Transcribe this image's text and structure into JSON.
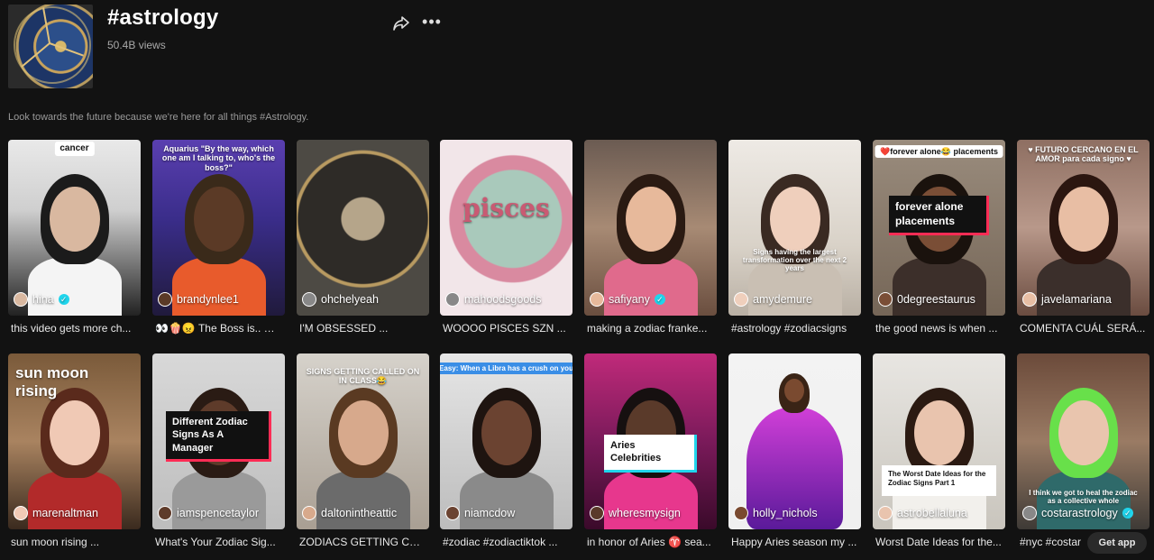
{
  "header": {
    "title": "#astrology",
    "views": "50.4B views",
    "share_icon": "share-icon",
    "more_icon": "more-icon"
  },
  "description": "Look towards the future because we're here for all things #Astrology.",
  "videos": [
    {
      "author": "hina",
      "verified": true,
      "title": "this video gets more ch...",
      "overlay": "cancer"
    },
    {
      "author": "brandynlee1",
      "verified": false,
      "title": "👀🍿😠 The Boss is.. 😰 ...",
      "overlay": "Aquarius \"By the way, which one am I talking to, who's the boss?\""
    },
    {
      "author": "ohchelyeah",
      "verified": false,
      "title": "I'M OBSESSED ...",
      "overlay": ""
    },
    {
      "author": "mahoodsgoods",
      "verified": false,
      "title": "WOOOO PISCES SZN ...",
      "overlay": "pisces"
    },
    {
      "author": "safiyany",
      "verified": true,
      "title": "making a zodiac franke...",
      "overlay": ""
    },
    {
      "author": "amydemure",
      "verified": false,
      "title": "#astrology #zodiacsigns",
      "overlay": "Signs having the largest transformation over the next 2 years"
    },
    {
      "author": "0degreestaurus",
      "verified": false,
      "title": "the good news is when ...",
      "overlay": "❤️forever alone😂 placements",
      "box": "forever alone placements"
    },
    {
      "author": "javelamariana",
      "verified": false,
      "title": "COMENTA CUÁL SERÁ...",
      "overlay": "♥ FUTURO CERCANO EN EL AMOR para cada signo ♥"
    },
    {
      "author": "marenaltman",
      "verified": false,
      "title": "sun moon rising ...",
      "overlay": "sun moon rising"
    },
    {
      "author": "iamspencetaylor",
      "verified": false,
      "title": "What's Your Zodiac Sig...",
      "overlay": "",
      "box": "Different Zodiac Signs As A Manager"
    },
    {
      "author": "daltonintheattic",
      "verified": false,
      "title": "ZODIACS GETTING CAL...",
      "overlay": "SIGNS GETTING CALLED ON IN CLASS😂"
    },
    {
      "author": "niamcdow",
      "verified": false,
      "title": "#zodiac #zodiactiktok ...",
      "overlay": "Easy: When a Libra has a crush on you"
    },
    {
      "author": "wheresmysign",
      "verified": false,
      "title": "in honor of Aries ♈ sea...",
      "overlay": "",
      "box": "Aries Celebrities"
    },
    {
      "author": "holly_nichols",
      "verified": false,
      "title": "Happy Aries season my ...",
      "overlay": ""
    },
    {
      "author": "astrobellaluna",
      "verified": false,
      "title": "Worst Date Ideas for the...",
      "overlay": "",
      "box": "The Worst Date Ideas for the Zodiac Signs Part 1"
    },
    {
      "author": "costarastrology",
      "verified": true,
      "title": "#nyc #costar",
      "overlay": "I think we got to heal the zodiac as a collective whole"
    }
  ],
  "get_app": "Get app",
  "colors": {
    "background": "#121212",
    "verified": "#20d5ec",
    "caption_red": "#fe2c55"
  }
}
